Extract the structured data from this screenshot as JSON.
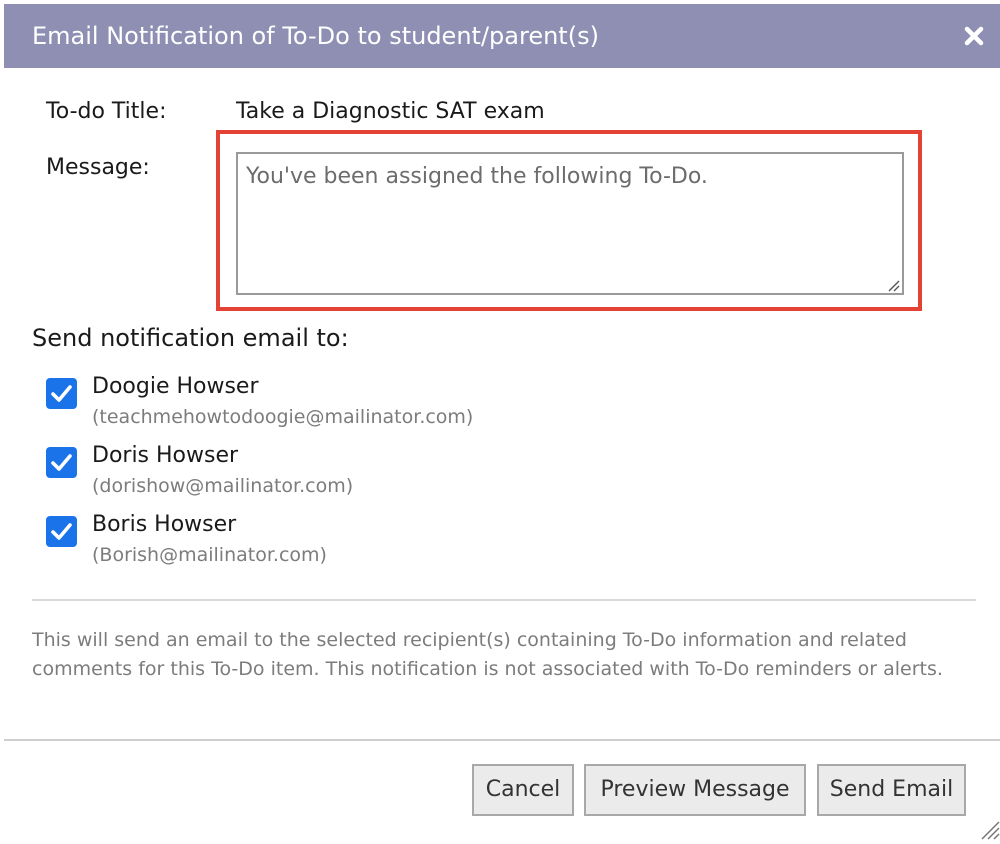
{
  "dialog": {
    "title": "Email Notification of To-Do to student/parent(s)",
    "titlebar_color": "#8f8fb4",
    "close_icon": "close-icon"
  },
  "todo": {
    "title_label": "To-do Title:",
    "title_value": "Take a Diagnostic SAT exam",
    "message_label": "Message:",
    "message_value": "You've been assigned the following To-Do.",
    "highlight_color": "#e34234"
  },
  "recipients": {
    "heading": "Send notification email to:",
    "items": [
      {
        "name": "Doogie Howser",
        "email": "(teachmehowtodoogie@mailinator.com)",
        "checked": true
      },
      {
        "name": "Doris Howser",
        "email": "(dorishow@mailinator.com)",
        "checked": true
      },
      {
        "name": "Boris Howser",
        "email": "(Borish@mailinator.com)",
        "checked": true
      }
    ],
    "checkbox_color": "#1a73e8"
  },
  "info": {
    "text": "This will send an email to the selected recipient(s) containing To-Do information and related comments for this To-Do item. This notification is not associated with To-Do reminders or alerts."
  },
  "footer": {
    "cancel_label": "Cancel",
    "preview_label": "Preview Message",
    "send_label": "Send Email"
  }
}
